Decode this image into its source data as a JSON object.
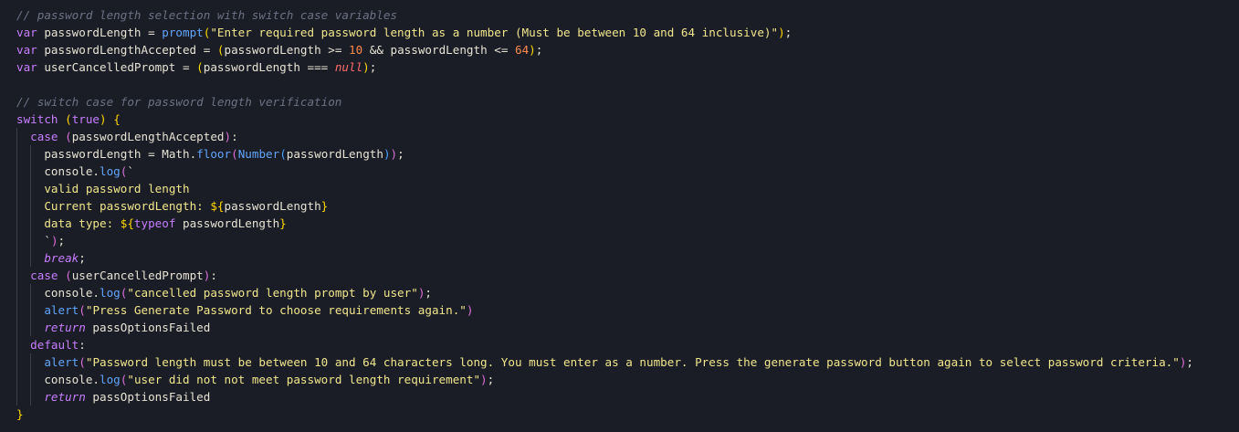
{
  "editor": {
    "background": "#1b1d26",
    "language": "javascript",
    "lines": [
      {
        "indent": 0,
        "tokens": [
          [
            "comment",
            "// password length selection with switch case variables"
          ]
        ]
      },
      {
        "indent": 0,
        "tokens": [
          [
            "keyword",
            "var"
          ],
          [
            "ident",
            " passwordLength "
          ],
          [
            "op",
            "= "
          ],
          [
            "func",
            "prompt"
          ],
          [
            "pgold",
            "("
          ],
          [
            "string",
            "\"Enter required password length as a number (Must be between 10 and 64 inclusive)\""
          ],
          [
            "pgold",
            ")"
          ],
          [
            "punct",
            ";"
          ]
        ]
      },
      {
        "indent": 0,
        "tokens": [
          [
            "keyword",
            "var"
          ],
          [
            "ident",
            " passwordLengthAccepted "
          ],
          [
            "op",
            "= "
          ],
          [
            "pgold",
            "("
          ],
          [
            "ident",
            "passwordLength "
          ],
          [
            "op",
            ">= "
          ],
          [
            "number",
            "10"
          ],
          [
            "op",
            " && "
          ],
          [
            "ident",
            "passwordLength "
          ],
          [
            "op",
            "<= "
          ],
          [
            "number",
            "64"
          ],
          [
            "pgold",
            ")"
          ],
          [
            "punct",
            ";"
          ]
        ]
      },
      {
        "indent": 0,
        "tokens": [
          [
            "keyword",
            "var"
          ],
          [
            "ident",
            " userCancelledPrompt "
          ],
          [
            "op",
            "= "
          ],
          [
            "pgold",
            "("
          ],
          [
            "ident",
            "passwordLength "
          ],
          [
            "op",
            "=== "
          ],
          [
            "null",
            "null"
          ],
          [
            "pgold",
            ")"
          ],
          [
            "punct",
            ";"
          ]
        ]
      },
      {
        "indent": 0,
        "tokens": []
      },
      {
        "indent": 0,
        "tokens": [
          [
            "comment",
            "// switch case for password length verification"
          ]
        ]
      },
      {
        "indent": 0,
        "tokens": [
          [
            "keyword",
            "switch"
          ],
          [
            "ident",
            " "
          ],
          [
            "pgold",
            "("
          ],
          [
            "keyword",
            "true"
          ],
          [
            "pgold",
            ")"
          ],
          [
            "ident",
            " "
          ],
          [
            "pgold",
            "{"
          ]
        ]
      },
      {
        "indent": 1,
        "tokens": [
          [
            "keyword",
            "case"
          ],
          [
            "ident",
            " "
          ],
          [
            "ppink",
            "("
          ],
          [
            "ident",
            "passwordLengthAccepted"
          ],
          [
            "ppink",
            ")"
          ],
          [
            "punct",
            ":"
          ]
        ]
      },
      {
        "indent": 2,
        "tokens": [
          [
            "ident",
            "passwordLength "
          ],
          [
            "op",
            "= "
          ],
          [
            "ident",
            "Math"
          ],
          [
            "punct",
            "."
          ],
          [
            "func",
            "floor"
          ],
          [
            "ppink",
            "("
          ],
          [
            "func",
            "Number"
          ],
          [
            "pblue",
            "("
          ],
          [
            "ident",
            "passwordLength"
          ],
          [
            "pblue",
            ")"
          ],
          [
            "ppink",
            ")"
          ],
          [
            "punct",
            ";"
          ]
        ]
      },
      {
        "indent": 2,
        "tokens": [
          [
            "ident",
            "console"
          ],
          [
            "punct",
            "."
          ],
          [
            "func",
            "log"
          ],
          [
            "ppink",
            "("
          ],
          [
            "template",
            "`"
          ]
        ]
      },
      {
        "indent": 2,
        "tokens": [
          [
            "string",
            "valid password length"
          ]
        ]
      },
      {
        "indent": 2,
        "tokens": [
          [
            "string",
            "Current passwordLength: "
          ],
          [
            "pgold",
            "${"
          ],
          [
            "ident",
            "passwordLength"
          ],
          [
            "pgold",
            "}"
          ]
        ]
      },
      {
        "indent": 2,
        "tokens": [
          [
            "string",
            "data type: "
          ],
          [
            "pgold",
            "${"
          ],
          [
            "keyword",
            "typeof"
          ],
          [
            "ident",
            " passwordLength"
          ],
          [
            "pgold",
            "}"
          ]
        ]
      },
      {
        "indent": 2,
        "tokens": [
          [
            "template",
            "`"
          ],
          [
            "ppink",
            ")"
          ],
          [
            "punct",
            ";"
          ]
        ]
      },
      {
        "indent": 2,
        "tokens": [
          [
            "ikeyword",
            "break"
          ],
          [
            "punct",
            ";"
          ]
        ]
      },
      {
        "indent": 1,
        "tokens": [
          [
            "keyword",
            "case"
          ],
          [
            "ident",
            " "
          ],
          [
            "ppink",
            "("
          ],
          [
            "ident",
            "userCancelledPrompt"
          ],
          [
            "ppink",
            ")"
          ],
          [
            "punct",
            ":"
          ]
        ]
      },
      {
        "indent": 2,
        "tokens": [
          [
            "ident",
            "console"
          ],
          [
            "punct",
            "."
          ],
          [
            "func",
            "log"
          ],
          [
            "ppink",
            "("
          ],
          [
            "string",
            "\"cancelled password length prompt by user\""
          ],
          [
            "ppink",
            ")"
          ],
          [
            "punct",
            ";"
          ]
        ]
      },
      {
        "indent": 2,
        "tokens": [
          [
            "func",
            "alert"
          ],
          [
            "ppink",
            "("
          ],
          [
            "string",
            "\"Press Generate Password to choose requirements again.\""
          ],
          [
            "ppink",
            ")"
          ]
        ]
      },
      {
        "indent": 2,
        "tokens": [
          [
            "ikeyword",
            "return"
          ],
          [
            "ident",
            " passOptionsFailed"
          ]
        ]
      },
      {
        "indent": 1,
        "tokens": [
          [
            "keyword",
            "default"
          ],
          [
            "punct",
            ":"
          ]
        ]
      },
      {
        "indent": 2,
        "tokens": [
          [
            "func",
            "alert"
          ],
          [
            "ppink",
            "("
          ],
          [
            "string",
            "\"Password length must be between 10 and 64 characters long. You must enter as a number. Press the generate password button again to select password criteria.\""
          ],
          [
            "ppink",
            ")"
          ],
          [
            "punct",
            ";"
          ]
        ]
      },
      {
        "indent": 2,
        "tokens": [
          [
            "ident",
            "console"
          ],
          [
            "punct",
            "."
          ],
          [
            "func",
            "log"
          ],
          [
            "ppink",
            "("
          ],
          [
            "string",
            "\"user did not not meet password length requirement\""
          ],
          [
            "ppink",
            ")"
          ],
          [
            "punct",
            ";"
          ]
        ]
      },
      {
        "indent": 2,
        "tokens": [
          [
            "ikeyword",
            "return"
          ],
          [
            "ident",
            " passOptionsFailed"
          ]
        ]
      },
      {
        "indent": 0,
        "tokens": [
          [
            "pgold",
            "}"
          ]
        ]
      }
    ]
  }
}
